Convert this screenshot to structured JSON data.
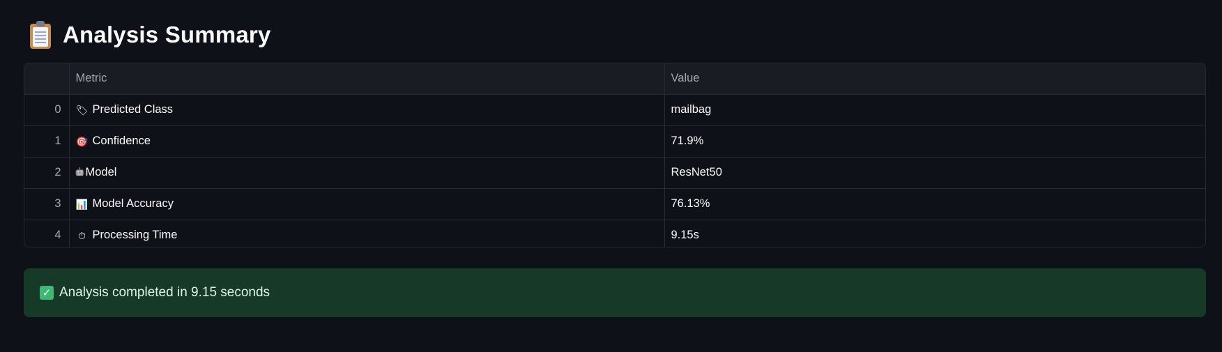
{
  "header": {
    "title": "Analysis Summary",
    "icon": "clipboard-icon"
  },
  "table": {
    "columns": [
      "",
      "Metric",
      "Value"
    ],
    "rows": [
      {
        "index": "0",
        "icon": "tag-icon",
        "glyph": "🏷",
        "metric": "Predicted Class",
        "value": "mailbag"
      },
      {
        "index": "1",
        "icon": "target-icon",
        "glyph": "🎯",
        "metric": "Confidence",
        "value": "71.9%"
      },
      {
        "index": "2",
        "icon": "robot-icon",
        "glyph": "🤖",
        "metric": "Model",
        "value": "ResNet50"
      },
      {
        "index": "3",
        "icon": "bar-chart-icon",
        "glyph": "📊",
        "metric": "Model Accuracy",
        "value": "76.13%"
      },
      {
        "index": "4",
        "icon": "stopwatch-icon",
        "glyph": "⏱",
        "metric": "Processing Time",
        "value": "9.15s"
      }
    ]
  },
  "status": {
    "icon": "check-mark-icon",
    "message": "Analysis completed in 9.15 seconds",
    "background": "#173928",
    "accent": "#3fb874"
  },
  "theme": {
    "background": "#0e1117",
    "header_background": "#1a1c24",
    "border": "#262a33"
  }
}
